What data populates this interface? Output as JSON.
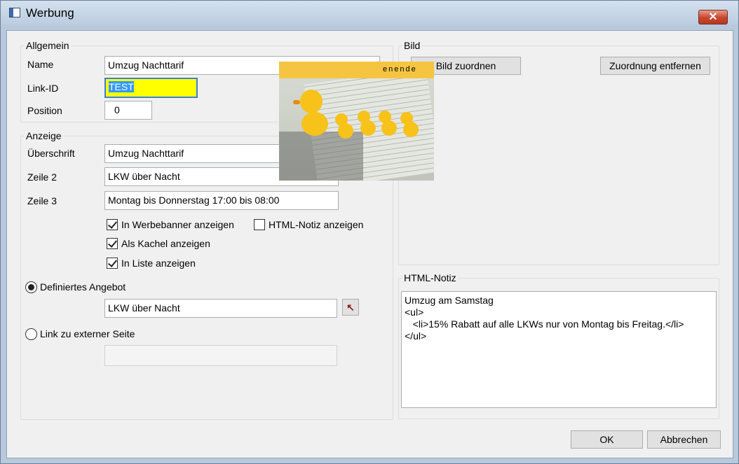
{
  "window": {
    "title": "Werbung",
    "close_label": "✕"
  },
  "allgemein": {
    "legend": "Allgemein",
    "name_label": "Name",
    "name_value": "Umzug Nachttarif",
    "linkid_label": "Link-ID",
    "linkid_value": "TEST",
    "position_label": "Position",
    "position_value": "0"
  },
  "anzeige": {
    "legend": "Anzeige",
    "ueberschrift_label": "Überschrift",
    "ueberschrift_value": "Umzug Nachttarif",
    "zeile2_label": "Zeile 2",
    "zeile2_value": "LKW über Nacht",
    "zeile3_label": "Zeile 3",
    "zeile3_value": "Montag bis Donnerstag 17:00 bis 08:00",
    "cb_werbebanner": "In Werbebanner anzeigen",
    "cb_html_notiz": "HTML-Notiz anzeigen",
    "cb_kachel": "Als Kachel anzeigen",
    "cb_liste": "In Liste anzeigen",
    "checked": {
      "werbebanner": true,
      "html_notiz": false,
      "kachel": true,
      "liste": true
    },
    "radio_angebot": "Definiertes Angebot",
    "angebot_value": "LKW über Nacht",
    "radio_extern": "Link zu externer Seite",
    "extern_value": ""
  },
  "bild": {
    "legend": "Bild",
    "zuordnen_label": "Bild zuordnen",
    "entfernen_label": "Zuordnung entfernen",
    "image_banner_text": "enende"
  },
  "html_notiz": {
    "legend": "HTML-Notiz",
    "content": "Umzug am Samstag\n<ul>\n   <li>15% Rabatt auf alle LKWs nur von Montag bis Freitag.</li>\n</ul>"
  },
  "footer": {
    "ok_label": "OK",
    "cancel_label": "Abbrechen"
  },
  "icons": {
    "window": "window-icon",
    "pick": "arrow-up-left-icon"
  }
}
